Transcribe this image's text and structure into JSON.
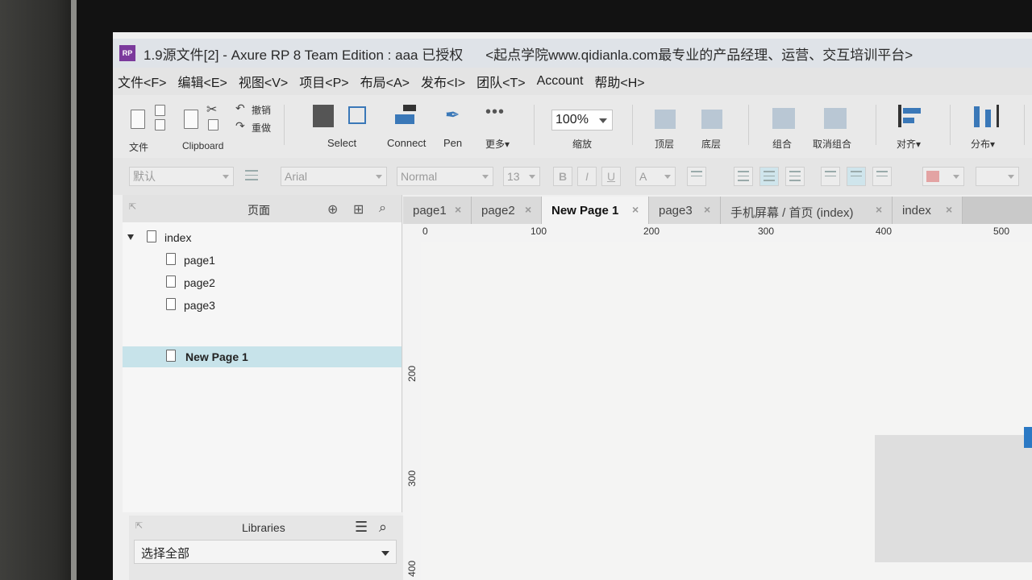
{
  "window": {
    "title": "1.9源文件[2] - Axure RP 8 Team Edition : aaa 已授权",
    "title_suffix": "<起点学院www.qidianla.com最专业的产品经理、运营、交互培训平台>",
    "app_icon": "RP"
  },
  "menu": [
    "文件<F>",
    "编辑<E>",
    "视图<V>",
    "项目<P>",
    "布局<A>",
    "发布<I>",
    "团队<T>",
    "Account",
    "帮助<H>"
  ],
  "toolbar": {
    "file_label": "文件",
    "clipboard_label": "Clipboard",
    "undo_label": "撤销",
    "redo_label": "重做",
    "select_label": "Select",
    "connect_label": "Connect",
    "pen_label": "Pen",
    "more_label": "更多▾",
    "zoom_value": "100%",
    "zoom_label": "缩放",
    "top_label": "顶层",
    "bottom_label": "底层",
    "group_label": "组合",
    "ungroup_label": "取消组合",
    "align_label": "对齐▾",
    "distribute_label": "分布▾"
  },
  "format": {
    "style_value": "默认",
    "font_value": "Arial",
    "weight_value": "Normal",
    "size_value": "13",
    "bold": "B",
    "italic": "I",
    "underline": "U",
    "font_color": "A"
  },
  "pages_panel": {
    "title": "页面",
    "tree": [
      {
        "label": "index",
        "level": 0
      },
      {
        "label": "page1",
        "level": 1
      },
      {
        "label": "page2",
        "level": 1
      },
      {
        "label": "page3",
        "level": 1
      },
      {
        "label": "New Page 1",
        "level": 1,
        "selected": true
      }
    ]
  },
  "libraries": {
    "title": "Libraries",
    "selected": "选择全部"
  },
  "tabs": [
    {
      "label": "page1"
    },
    {
      "label": "page2"
    },
    {
      "label": "New Page 1",
      "active": true
    },
    {
      "label": "page3"
    },
    {
      "label": "手机屏幕 / 首页 (index)"
    },
    {
      "label": "index"
    }
  ],
  "ruler": {
    "top": [
      "0",
      "100",
      "200",
      "300",
      "400",
      "500"
    ],
    "left": [
      "200",
      "300",
      "400"
    ]
  },
  "colors": {
    "accent": "#2b79c4",
    "selected_row": "#c7e3ea"
  }
}
